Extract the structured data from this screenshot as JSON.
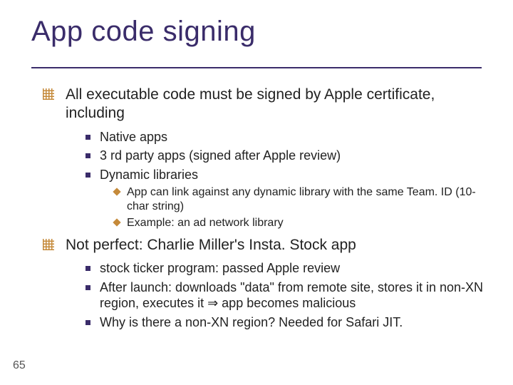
{
  "title": "App code signing",
  "section1": {
    "heading": "All executable code must be signed by Apple certificate, including",
    "items": [
      "Native apps",
      "3 rd party apps (signed after Apple review)",
      "Dynamic libraries"
    ],
    "subitems": [
      "App can link against any dynamic library with the same Team. ID (10-char string)",
      "Example:   an ad network library"
    ]
  },
  "section2": {
    "heading": "Not perfect:   Charlie Miller's  Insta. Stock  app",
    "items": [
      "stock ticker program:   passed Apple review",
      "After launch: downloads \"data\" from remote site,  stores it in non-XN region,  executes it   ⇒  app becomes malicious",
      "Why is there a non-XN region?     Needed for Safari JIT."
    ]
  },
  "pagenum": "65"
}
